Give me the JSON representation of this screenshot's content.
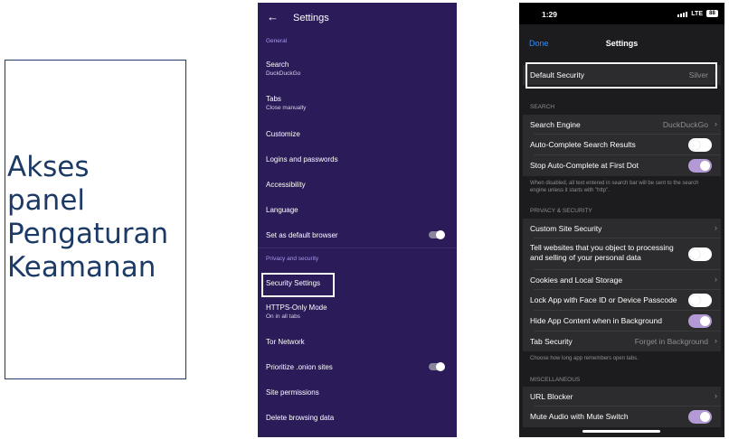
{
  "caption": {
    "text": " Akses\npanel\nPengaturan\nKeamanan"
  },
  "android": {
    "title": "Settings",
    "back_icon": "arrow-left-icon",
    "sections": {
      "general": "General",
      "privacy": "Privacy and security"
    },
    "items": [
      {
        "label": "Search",
        "sub": "DuckDuckGo"
      },
      {
        "label": "Tabs",
        "sub": "Close manually"
      },
      {
        "label": "Customize"
      },
      {
        "label": "Logins and passwords"
      },
      {
        "label": "Accessibility"
      },
      {
        "label": "Language"
      },
      {
        "label": "Set as default browser",
        "toggle": "off"
      },
      {
        "label": "Security Settings"
      },
      {
        "label": "HTTPS-Only Mode",
        "sub": "On in all tabs"
      },
      {
        "label": "Tor Network"
      },
      {
        "label": "Prioritize .onion sites",
        "toggle": "off"
      },
      {
        "label": "Site permissions"
      },
      {
        "label": "Delete browsing data"
      }
    ]
  },
  "ios": {
    "status": {
      "time": "1:29",
      "network": "LTE",
      "battery": "88"
    },
    "nav": {
      "done": "Done",
      "title": "Settings"
    },
    "default_security": {
      "label": "Default Security",
      "value": "Silver"
    },
    "sections": {
      "search": "Search",
      "privacy": "Privacy & Security",
      "misc": "Miscellaneous"
    },
    "search_rows": [
      {
        "label": "Search Engine",
        "value": "DuckDuckGo"
      },
      {
        "label": "Auto-Complete Search Results",
        "toggle": "off"
      },
      {
        "label": "Stop Auto-Complete at First Dot",
        "toggle": "on"
      }
    ],
    "search_footer": "When disabled, all text entered in search bar will be sent to the search engine unless it starts with \"http\".",
    "privacy_rows": [
      {
        "label": "Custom Site Security"
      },
      {
        "label": "Tell websites that you object to processing and selling of your personal data",
        "toggle": "off"
      },
      {
        "label": "Cookies and Local Storage"
      },
      {
        "label": "Lock App with Face ID or Device Passcode",
        "toggle": "off"
      },
      {
        "label": "Hide App Content when in Background",
        "toggle": "on"
      },
      {
        "label": "Tab Security",
        "value": "Forget in Background"
      }
    ],
    "privacy_footer": "Choose how long app remembers open tabs.",
    "misc_rows": [
      {
        "label": "URL Blocker"
      },
      {
        "label": "Mute Audio with Mute Switch",
        "toggle": "on"
      }
    ],
    "accent_color": "#b39ad6",
    "link_color": "#2f8cf5"
  }
}
